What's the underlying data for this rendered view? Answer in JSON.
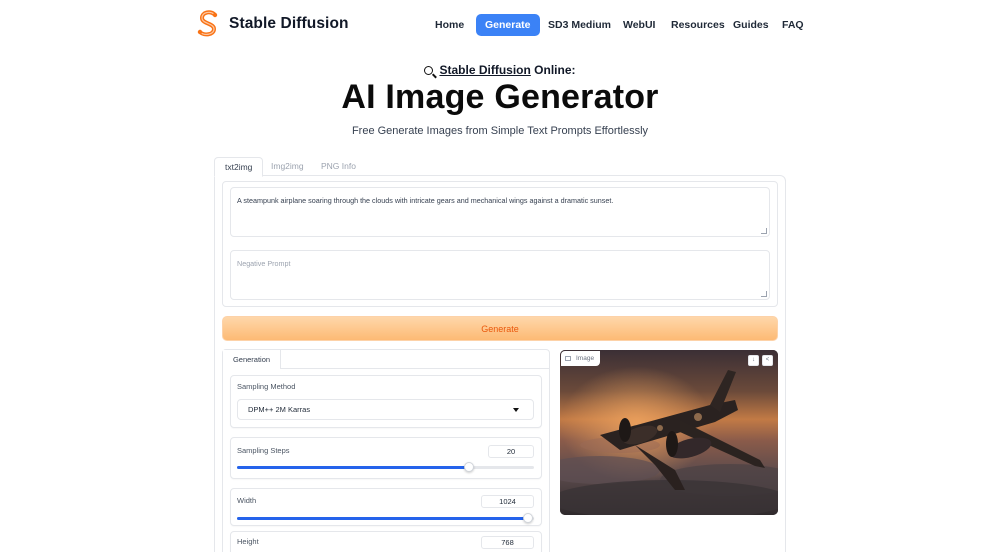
{
  "brand": {
    "name": "Stable Diffusion"
  },
  "nav": {
    "items": [
      {
        "label": "Home"
      },
      {
        "label": "Generate"
      },
      {
        "label": "SD3 Medium"
      },
      {
        "label": "WebUI"
      },
      {
        "label": "Resources"
      },
      {
        "label": "Guides"
      },
      {
        "label": "FAQ"
      }
    ]
  },
  "hero": {
    "kicker_link": "Stable Diffusion",
    "kicker_suffix": " Online:",
    "title": "AI Image Generator",
    "description": "Free Generate Images from Simple Text Prompts Effortlessly"
  },
  "tabs": [
    {
      "label": "txt2img"
    },
    {
      "label": "Img2img"
    },
    {
      "label": "PNG Info"
    }
  ],
  "prompt": {
    "value": "A steampunk airplane soaring through the clouds with intricate gears and mechanical wings against a dramatic sunset.",
    "negative_placeholder": "Negative Prompt"
  },
  "generate_label": "Generate",
  "generation_tab": "Generation",
  "settings": {
    "sampling_method": {
      "label": "Sampling Method",
      "value": "DPM++ 2M Karras"
    },
    "sampling_steps": {
      "label": "Sampling Steps",
      "value": "20",
      "fraction": 0.78
    },
    "width": {
      "label": "Width",
      "value": "1024",
      "fraction": 0.98
    },
    "height": {
      "label": "Height",
      "value": "768"
    }
  },
  "output": {
    "label": "Image",
    "download_icon": "download-icon",
    "share_icon": "share-icon"
  },
  "colors": {
    "accent": "#3b82f6",
    "generate_text": "#ea580c",
    "slider": "#2563eb"
  }
}
